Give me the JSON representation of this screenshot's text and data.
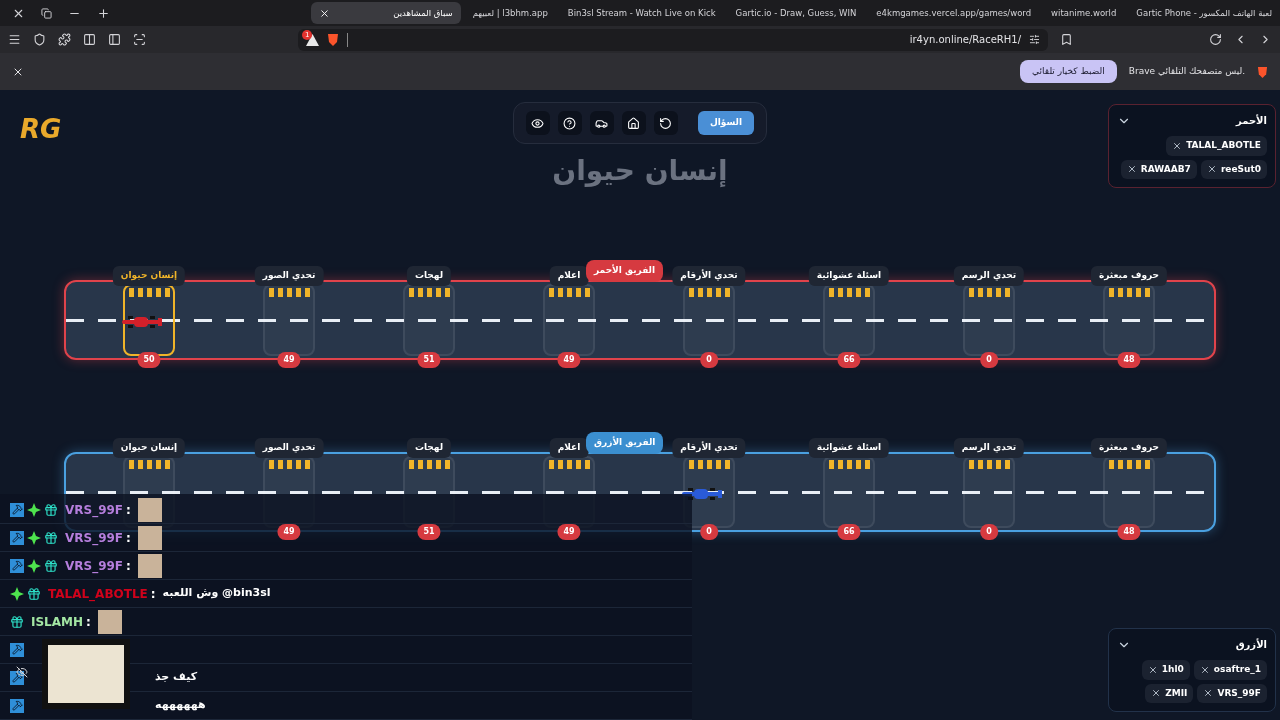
{
  "browser": {
    "tabs": [
      {
        "title": "لعبة الهاتف المكسور - Gartic Phone",
        "selected": false
      },
      {
        "title": "witanime.world",
        "selected": false
      },
      {
        "title": "e4kmgames.vercel.app/games/word",
        "selected": false
      },
      {
        "title": "Gartic.io - Draw, Guess, WIN",
        "selected": false
      },
      {
        "title": "Bin3sl Stream - Watch Live on Kick",
        "selected": false
      },
      {
        "title": "l3bhm.app | لعبيهم",
        "selected": false
      },
      {
        "title": "سباق المشاهدين",
        "selected": true
      }
    ],
    "shield_count": "1",
    "url": "ir4yn.online/RaceRH1/",
    "infobar": {
      "message": "Brave ليس متصفحك التلقائي.",
      "button": "الضبط كخيار تلقائي"
    }
  },
  "game": {
    "logo": "RG",
    "toolbar": {
      "question_button": "السؤال"
    },
    "heading": "إنسان حيوان",
    "tracks": [
      {
        "kind": "red",
        "label": "الفريق الأحمر",
        "stations": [
          {
            "name": "حروف مبعثرة",
            "score": "48",
            "selected": false,
            "car": false
          },
          {
            "name": "تحدي الرسم",
            "score": "0",
            "selected": false,
            "car": false
          },
          {
            "name": "اسئلة عشوائية",
            "score": "66",
            "selected": false,
            "car": false
          },
          {
            "name": "تحدي الأرقام",
            "score": "0",
            "selected": false,
            "car": false
          },
          {
            "name": "اعلام",
            "score": "49",
            "selected": false,
            "car": false
          },
          {
            "name": "لهجات",
            "score": "51",
            "selected": false,
            "car": false
          },
          {
            "name": "تحدي الصور",
            "score": "49",
            "selected": false,
            "car": false
          },
          {
            "name": "إنسان حيوان",
            "score": "50",
            "selected": true,
            "car": true
          }
        ]
      },
      {
        "kind": "blue",
        "label": "الفريق الأزرق",
        "stations": [
          {
            "name": "حروف مبعثرة",
            "score": "48",
            "selected": false,
            "car": false
          },
          {
            "name": "تحدي الرسم",
            "score": "0",
            "selected": false,
            "car": false
          },
          {
            "name": "اسئلة عشوائية",
            "score": "66",
            "selected": false,
            "car": false
          },
          {
            "name": "تحدي الأرقام",
            "score": "0",
            "selected": false,
            "car": true
          },
          {
            "name": "اعلام",
            "score": "49",
            "selected": false,
            "car": false
          },
          {
            "name": "لهجات",
            "score": "51",
            "selected": false,
            "car": false
          },
          {
            "name": "تحدي الصور",
            "score": "49",
            "selected": false,
            "car": false
          },
          {
            "name": "إنسان حيوان",
            "selected": false,
            "car": false
          }
        ]
      }
    ],
    "teams": [
      {
        "kind": "red",
        "title": "الأحمر",
        "players": [
          "TALAL_ABOTLE",
          "reeSut0",
          "RAWAAB7"
        ]
      },
      {
        "kind": "blue",
        "title": "الأزرق",
        "players": [
          "osaftre_1",
          "1hl0",
          "VRS_99F",
          "ZMII"
        ]
      }
    ],
    "chat": [
      {
        "badges": [
          {
            "kind": "mod"
          },
          {
            "kind": "vip"
          },
          {
            "kind": "sub"
          }
        ],
        "user": "VRS_99F",
        "separator": ":",
        "color": "#b57edc",
        "kind": "emote"
      },
      {
        "badges": [
          {
            "kind": "mod"
          },
          {
            "kind": "vip"
          },
          {
            "kind": "sub"
          }
        ],
        "user": "VRS_99F",
        "separator": ":",
        "color": "#b57edc",
        "kind": "emote"
      },
      {
        "badges": [
          {
            "kind": "mod"
          },
          {
            "kind": "vip"
          },
          {
            "kind": "sub"
          }
        ],
        "user": "VRS_99F",
        "separator": ":",
        "color": "#b57edc",
        "kind": "emote"
      },
      {
        "badges": [
          {
            "kind": "vip"
          },
          {
            "kind": "sub"
          }
        ],
        "user": "TALAL_ABOTLE",
        "separator": ":",
        "color": "#d0021b",
        "kind": "text",
        "text": "وش اللعبه @bin3sl"
      },
      {
        "badges": [
          {
            "kind": "sub"
          }
        ],
        "user": "ISLAMH",
        "separator": ":",
        "color": "#a3e6a3",
        "kind": "emote"
      },
      {
        "badges": [
          {
            "kind": "mod"
          }
        ],
        "kind": "covered"
      },
      {
        "badges": [
          {
            "kind": "mod"
          }
        ],
        "kind": "covered",
        "text": "كيف جذ"
      },
      {
        "badges": [
          {
            "kind": "mod"
          }
        ],
        "kind": "covered",
        "text": "ههههههه"
      }
    ]
  }
}
